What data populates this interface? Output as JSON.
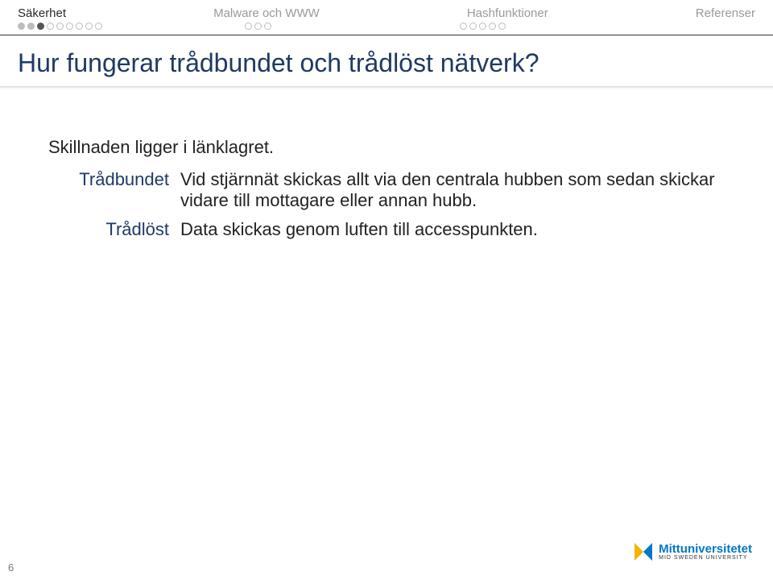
{
  "nav": {
    "sections": [
      {
        "label": "Säkerhet",
        "dots": 9,
        "progress": 3,
        "active": true
      },
      {
        "label": "Malware och WWW",
        "dots": 3,
        "progress": 0,
        "active": false
      },
      {
        "label": "Hashfunktioner",
        "dots": 5,
        "progress": 0,
        "active": false
      },
      {
        "label": "Referenser",
        "dots": 0,
        "progress": 0,
        "active": false
      }
    ]
  },
  "title": "Hur fungerar trådbundet och trådlöst nätverk?",
  "intro": "Skillnaden ligger i länklagret.",
  "items": [
    {
      "term": "Trådbundet",
      "def": "Vid stjärnnät skickas allt via den centrala hubben som sedan skickar vidare till mottagare eller annan hubb."
    },
    {
      "term": "Trådlöst",
      "def": "Data skickas genom luften till accesspunkten."
    }
  ],
  "page_number": "6",
  "logo": {
    "line1": "Mittuniversitetet",
    "line2": "MID SWEDEN UNIVERSITY"
  }
}
